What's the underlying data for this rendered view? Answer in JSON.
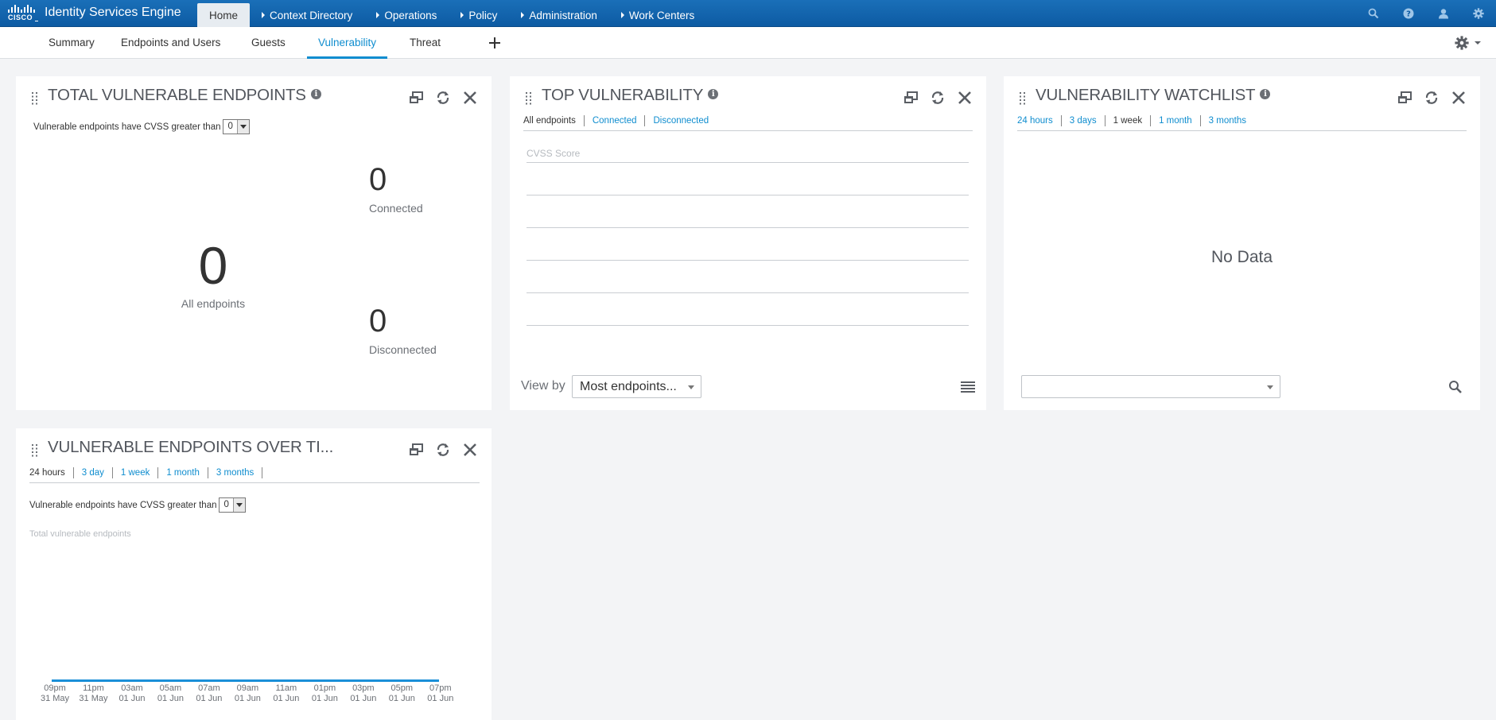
{
  "brand": {
    "word": "CISCO",
    "product": "Identity Services Engine"
  },
  "nav": [
    {
      "label": "Home",
      "active": true
    },
    {
      "label": "Context Directory"
    },
    {
      "label": "Operations"
    },
    {
      "label": "Policy"
    },
    {
      "label": "Administration"
    },
    {
      "label": "Work Centers"
    }
  ],
  "subtabs": [
    "Summary",
    "Endpoints and Users",
    "Guests",
    "Vulnerability",
    "Threat"
  ],
  "icons": {
    "search": "search-icon",
    "help": "help-icon",
    "user": "user-icon",
    "settings": "gear-icon",
    "add": "plus-icon",
    "drag": "drag-handle-icon",
    "info": "info-icon",
    "detach": "detach-icon",
    "refresh": "refresh-icon",
    "close": "close-icon",
    "list": "list-icon",
    "find": "magnifier-icon",
    "dropdown": "chevron-down-icon"
  },
  "colors": {
    "topbar": "#1a6fb8",
    "accent": "#0f8dcf",
    "background": "#f3f4f6"
  },
  "total_vulnerable": {
    "title": "TOTAL VULNERABLE ENDPOINTS",
    "cvss_text": "Vulnerable endpoints have CVSS greater than",
    "cvss_value": "0",
    "all_count": "0",
    "all_label": "All endpoints",
    "connected_count": "0",
    "connected_label": "Connected",
    "disconnected_count": "0",
    "disconnected_label": "Disconnected"
  },
  "top_vulnerability": {
    "title": "TOP VULNERABILITY",
    "filters": [
      "All endpoints",
      "Connected",
      "Disconnected"
    ],
    "score_label": "CVSS Score",
    "view_by_label": "View by",
    "view_by_value": "Most endpoints..."
  },
  "watchlist": {
    "title": "VULNERABILITY WATCHLIST",
    "filters": [
      "24 hours",
      "3 days",
      "1 week",
      "1 month",
      "3 months"
    ],
    "empty": "No Data",
    "select_value": ""
  },
  "over_time": {
    "title": "VULNERABLE ENDPOINTS OVER TI...",
    "filters": [
      "24 hours",
      "3 day",
      "1 week",
      "1 month",
      "3 months"
    ],
    "cvss_text": "Vulnerable endpoints have CVSS greater than",
    "cvss_value": "0",
    "y_title": "Total vulnerable endpoints"
  },
  "chart_data": {
    "type": "line",
    "title": "",
    "ylabel": "Total vulnerable endpoints",
    "x": [
      [
        "09pm",
        "31 May"
      ],
      [
        "11pm",
        "31 May"
      ],
      [
        "03am",
        "01 Jun"
      ],
      [
        "05am",
        "01 Jun"
      ],
      [
        "07am",
        "01 Jun"
      ],
      [
        "09am",
        "01 Jun"
      ],
      [
        "11am",
        "01 Jun"
      ],
      [
        "01pm",
        "01 Jun"
      ],
      [
        "03pm",
        "01 Jun"
      ],
      [
        "05pm",
        "01 Jun"
      ],
      [
        "07pm",
        "01 Jun"
      ]
    ],
    "series": [
      {
        "values": [
          0,
          0,
          0,
          0,
          0,
          0,
          0,
          0,
          0,
          0,
          0
        ]
      }
    ],
    "grid": false
  }
}
